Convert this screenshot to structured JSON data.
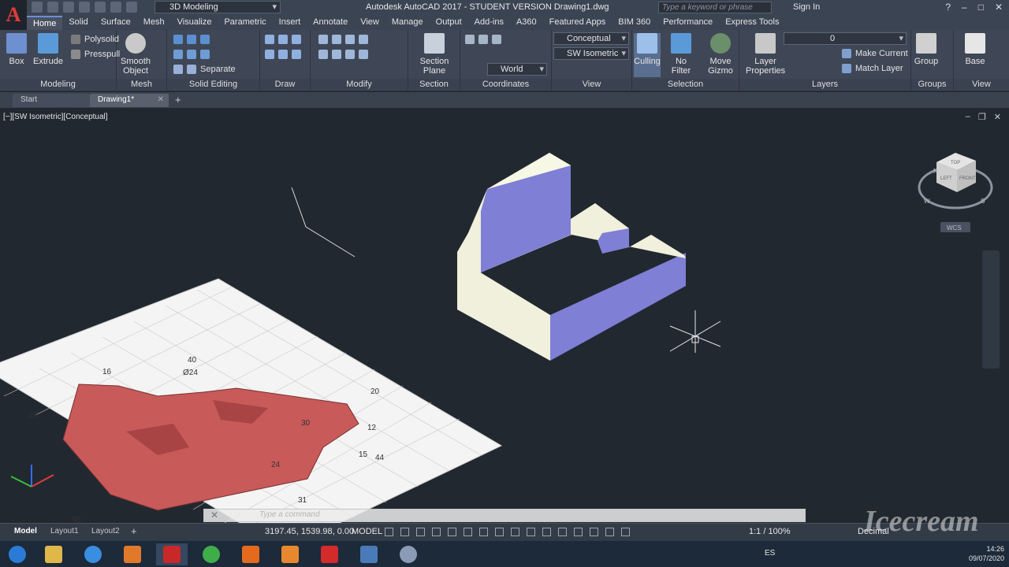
{
  "titlebar": {
    "workspace": "3D Modeling",
    "title": "Autodesk AutoCAD 2017 - STUDENT VERSION    Drawing1.dwg",
    "search_placeholder": "Type a keyword or phrase",
    "signin": "Sign In"
  },
  "menu_tabs": [
    "Home",
    "Solid",
    "Surface",
    "Mesh",
    "Visualize",
    "Parametric",
    "Insert",
    "Annotate",
    "View",
    "Manage",
    "Output",
    "Add-ins",
    "A360",
    "Featured Apps",
    "BIM 360",
    "Performance",
    "Express Tools"
  ],
  "ribbon": {
    "modeling": {
      "title": "Modeling",
      "box": "Box",
      "extrude": "Extrude",
      "polysolid": "Polysolid",
      "presspull": "Presspull"
    },
    "mesh": {
      "title": "Mesh",
      "smooth_object": "Smooth Object"
    },
    "solid_editing": {
      "title": "Solid Editing",
      "separate": "Separate"
    },
    "draw": {
      "title": "Draw"
    },
    "modify": {
      "title": "Modify"
    },
    "section": {
      "title": "Section",
      "section_plane": "Section Plane"
    },
    "coordinates": {
      "title": "Coordinates",
      "world": "World"
    },
    "view": {
      "title": "View",
      "visual_style": "Conceptual",
      "view_preset": "SW Isometric"
    },
    "selection": {
      "title": "Selection",
      "culling": "Culling",
      "no_filter": "No Filter",
      "move_gizmo": "Move Gizmo"
    },
    "layers": {
      "title": "Layers",
      "layer_properties": "Layer Properties",
      "layer_current": "0",
      "make_current": "Make Current",
      "match_layer": "Match Layer"
    },
    "groups": {
      "title": "Groups",
      "group": "Group"
    },
    "view2": {
      "title": "View",
      "base": "Base"
    }
  },
  "doc_tabs": [
    {
      "label": "Start"
    },
    {
      "label": "Drawing1*"
    }
  ],
  "viewport": {
    "label": "[−][SW Isometric][Conceptual]",
    "viewcube_wcs": "WCS",
    "viewcube_top": "TOP",
    "viewcube_left": "LEFT",
    "viewcube_front": "FRONT",
    "viewcube_n": "N",
    "viewcube_w": "W",
    "viewcube_s": "S"
  },
  "reference_drawing": {
    "dimensions": [
      "40",
      "Ø24",
      "16",
      "20",
      "20",
      "12",
      "15",
      "44",
      "24",
      "30",
      "31",
      "05"
    ]
  },
  "command_line": {
    "placeholder": "Type a command"
  },
  "statusbar": {
    "layouts": [
      "Model",
      "Layout1",
      "Layout2"
    ],
    "coordinates": "3197.45, 1539.98, 0.00",
    "model": "MODEL",
    "scale": "1:1 / 100%",
    "units": "Decimal"
  },
  "taskbar": {
    "language": "ES",
    "time": "14:26",
    "date": "09/07/2020"
  },
  "watermark": "Icecream",
  "colors": {
    "viewport_bg": "#212830",
    "solid_face_light": "#f0f0dc",
    "solid_face_side": "#7f7fd6",
    "reference_solid": "#c85a5a",
    "accent": "#6b8fd4"
  }
}
